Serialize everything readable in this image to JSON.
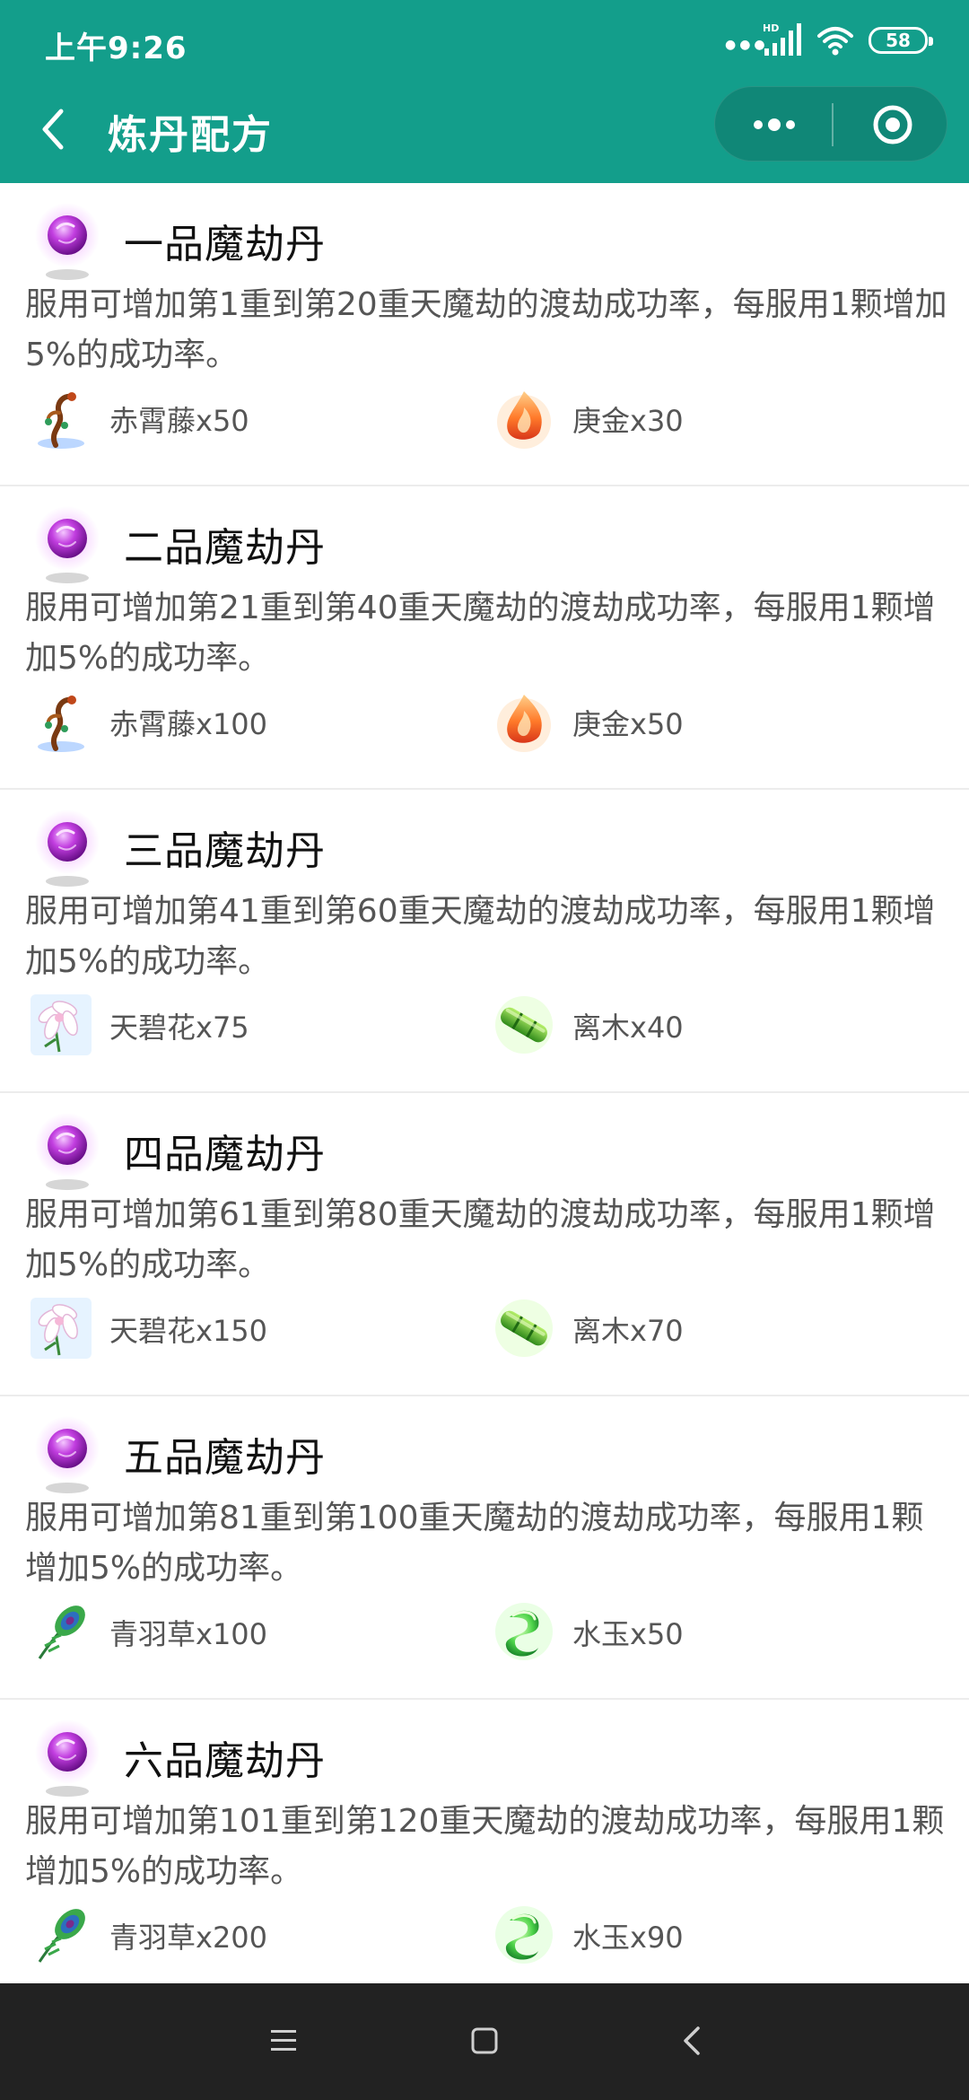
{
  "status_bar": {
    "time": "上午9:26",
    "network_label": "HD",
    "battery": "58"
  },
  "header": {
    "title": "炼丹配方",
    "background_color": "#139e8b"
  },
  "recipes": [
    {
      "name": "一品魔劫丹",
      "description": "服用可增加第1重到第20重天魔劫的渡劫成功率，每服用1颗增加5%的成功率。",
      "materials": [
        {
          "label": "赤霄藤x50",
          "icon": "red-vine-icon"
        },
        {
          "label": "庚金x30",
          "icon": "fire-crystal-icon"
        }
      ]
    },
    {
      "name": "二品魔劫丹",
      "description": "服用可增加第21重到第40重天魔劫的渡劫成功率，每服用1颗增加5%的成功率。",
      "materials": [
        {
          "label": "赤霄藤x100",
          "icon": "red-vine-icon"
        },
        {
          "label": "庚金x50",
          "icon": "fire-crystal-icon"
        }
      ]
    },
    {
      "name": "三品魔劫丹",
      "description": "服用可增加第41重到第60重天魔劫的渡劫成功率，每服用1颗增加5%的成功率。",
      "materials": [
        {
          "label": "天碧花x75",
          "icon": "white-flower-icon"
        },
        {
          "label": "离木x40",
          "icon": "green-bamboo-icon"
        }
      ]
    },
    {
      "name": "四品魔劫丹",
      "description": "服用可增加第61重到第80重天魔劫的渡劫成功率，每服用1颗增加5%的成功率。",
      "materials": [
        {
          "label": "天碧花x150",
          "icon": "white-flower-icon"
        },
        {
          "label": "离木x70",
          "icon": "green-bamboo-icon"
        }
      ]
    },
    {
      "name": "五品魔劫丹",
      "description": "服用可增加第81重到第100重天魔劫的渡劫成功率，每服用1颗增加5%的成功率。",
      "materials": [
        {
          "label": "青羽草x100",
          "icon": "peacock-feather-icon"
        },
        {
          "label": "水玉x50",
          "icon": "jade-icon"
        }
      ]
    },
    {
      "name": "六品魔劫丹",
      "description": "服用可增加第101重到第120重天魔劫的渡劫成功率，每服用1颗增加5%的成功率。",
      "materials": [
        {
          "label": "青羽草x200",
          "icon": "peacock-feather-icon"
        },
        {
          "label": "水玉x90",
          "icon": "jade-icon"
        }
      ]
    }
  ]
}
